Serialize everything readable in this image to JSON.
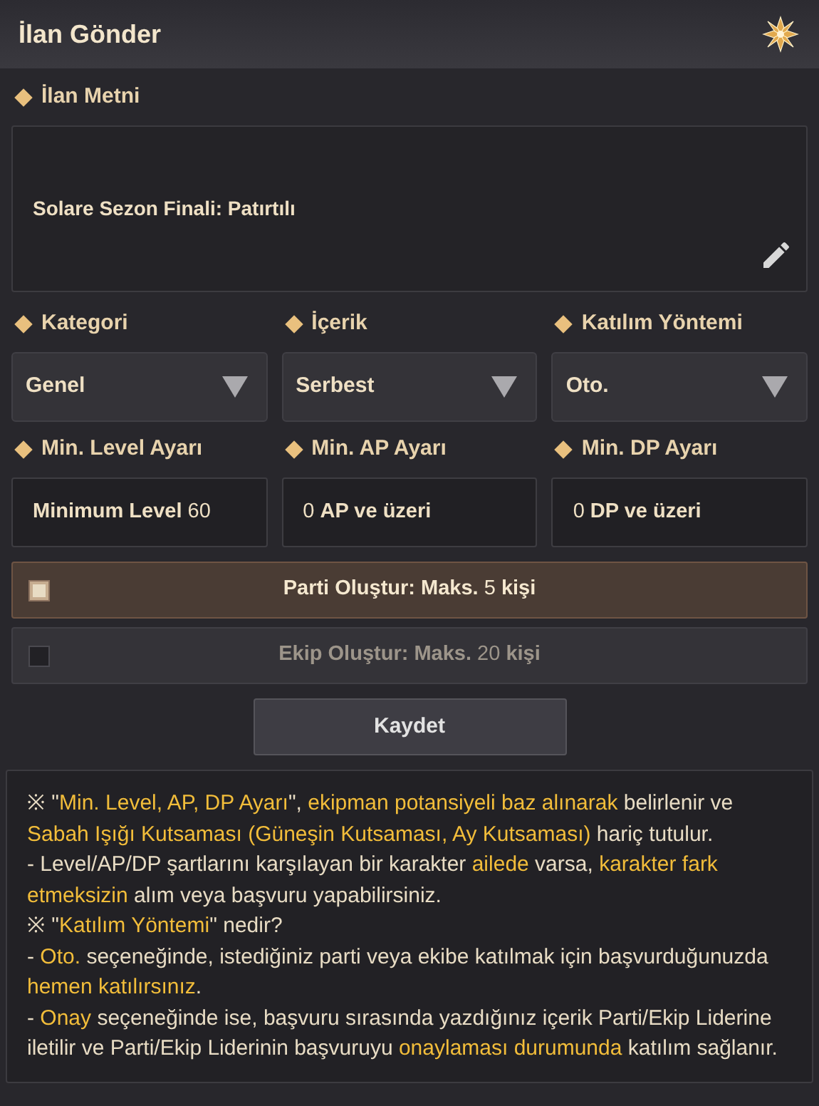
{
  "window": {
    "title": "İlan Gönder"
  },
  "ad_text": {
    "label": "İlan Metni",
    "value": "Solare Sezon Finali: Patırtılı"
  },
  "selects": [
    {
      "label": "Kategori",
      "value": "Genel"
    },
    {
      "label": "İçerik",
      "value": "Serbest"
    },
    {
      "label": "Katılım Yöntemi",
      "value": "Oto."
    }
  ],
  "min_fields": [
    {
      "label": "Min. Level Ayarı",
      "value": "**Minimum Level** 60"
    },
    {
      "label": "Min. AP Ayarı",
      "value": "0 **AP ve üzeri**"
    },
    {
      "label": "Min. DP Ayarı",
      "value": "0 **DP ve üzeri**"
    }
  ],
  "options": [
    {
      "label": "**Parti Oluştur: Maks.** 5 **kişi**",
      "checked": true
    },
    {
      "label": "**Ekip Oluştur: Maks.** 20 **kişi**",
      "checked": false
    }
  ],
  "save_button": "Kaydet",
  "notes": [
    "※ \"**Min. Level, AP, DP Ayarı**\", **ekipman potansiyeli baz alınarak** belirlenir ve **Sabah Işığı Kutsaması (Güneşin Kutsaması, Ay Kutsaması)** hariç tutulur.",
    "- Level/AP/DP şartlarını karşılayan bir karakter **ailede** varsa, **karakter fark etmeksizin** alım veya başvuru yapabilirsiniz.",
    "※ \"**Katılım Yöntemi**\" nedir?",
    "- **Oto.** seçeneğinde, istediğiniz parti veya ekibe katılmak için başvurduğunuzda **hemen katılırsınız**.",
    "- **Onay** seçeneğinde ise, başvuru sırasında yazdığınız içerik Parti/Ekip Liderine iletilir ve Parti/Ekip Liderinin başvuruyu **onaylaması durumunda** katılım sağlanır."
  ]
}
